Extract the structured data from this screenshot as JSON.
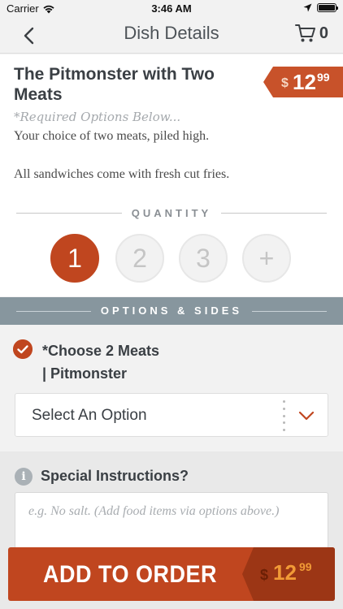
{
  "status_bar": {
    "carrier": "Carrier",
    "time": "3:46 AM"
  },
  "nav": {
    "title": "Dish Details",
    "cart_count": "0"
  },
  "dish": {
    "name": "The Pitmonster with Two Meats",
    "price": {
      "currency": "$",
      "dollars": "12",
      "cents": "99"
    },
    "required_note": "*Required Options Below...",
    "description_1": "Your choice of two meats, piled high.",
    "description_2": "All sandwiches come with fresh cut fries."
  },
  "quantity": {
    "label": "QUANTITY",
    "options": [
      "1",
      "2",
      "3",
      "+"
    ],
    "selected": "1"
  },
  "options_banner": {
    "label": "OPTIONS & SIDES"
  },
  "option_group": {
    "title_line1": "*Choose 2 Meats",
    "title_line2": "| Pitmonster",
    "select_value": "Select An Option"
  },
  "special": {
    "label": "Special Instructions?",
    "placeholder": "e.g. No salt. (Add food items via options above.)",
    "value": ""
  },
  "add_to_order": {
    "label": "ADD TO ORDER",
    "price": {
      "currency": "$",
      "dollars": "12",
      "cents": "99"
    }
  },
  "colors": {
    "accent": "#c0461f",
    "banner": "#87969e",
    "price_tag": "#c8522a",
    "button_price_bg": "#9c3615",
    "button_price_text": "#f19a36"
  }
}
